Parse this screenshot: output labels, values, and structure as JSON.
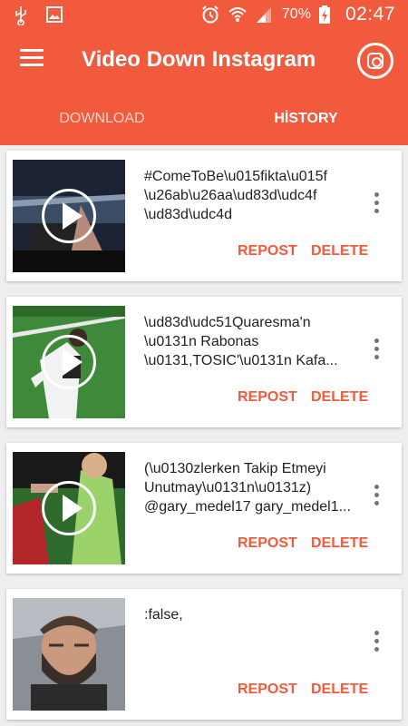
{
  "status_bar": {
    "battery_percent": "70%",
    "time": "02:47",
    "icons": [
      "usb-icon",
      "image-icon",
      "alarm-icon",
      "wifi-icon",
      "signal-icon",
      "battery-charging-icon"
    ]
  },
  "toolbar": {
    "title": "Video Down Instagram",
    "menu_icon": "hamburger-menu-icon",
    "instagram_icon": "instagram-icon"
  },
  "tabs": [
    {
      "label": "DOWNLOAD",
      "selected": false
    },
    {
      "label": "HİSTORY",
      "selected": true
    }
  ],
  "colors": {
    "primary": "#f15a3d",
    "background": "#eeeeee",
    "text": "#222222"
  },
  "history": [
    {
      "caption": "#ComeToBe\\u015fikta\\u015f\n\\u26ab\\u26aa\\ud83d\\udc4f\n\\ud83d\\udc4d",
      "repost_label": "REPOST",
      "delete_label": "DELETE"
    },
    {
      "caption": "\\ud83d\\udc51Quaresma'n\n\\u0131n Rabonas\n\\u0131,TOSIC'\\u0131n Kafa...",
      "repost_label": "REPOST",
      "delete_label": "DELETE"
    },
    {
      "caption": "(\\u0130zlerken Takip Etmeyi\nUnutmay\\u0131n\\u0131z)\n@gary_medel17 gary_medel1...",
      "repost_label": "REPOST",
      "delete_label": "DELETE"
    },
    {
      "caption": ":false,",
      "repost_label": "REPOST",
      "delete_label": "DELETE"
    }
  ]
}
